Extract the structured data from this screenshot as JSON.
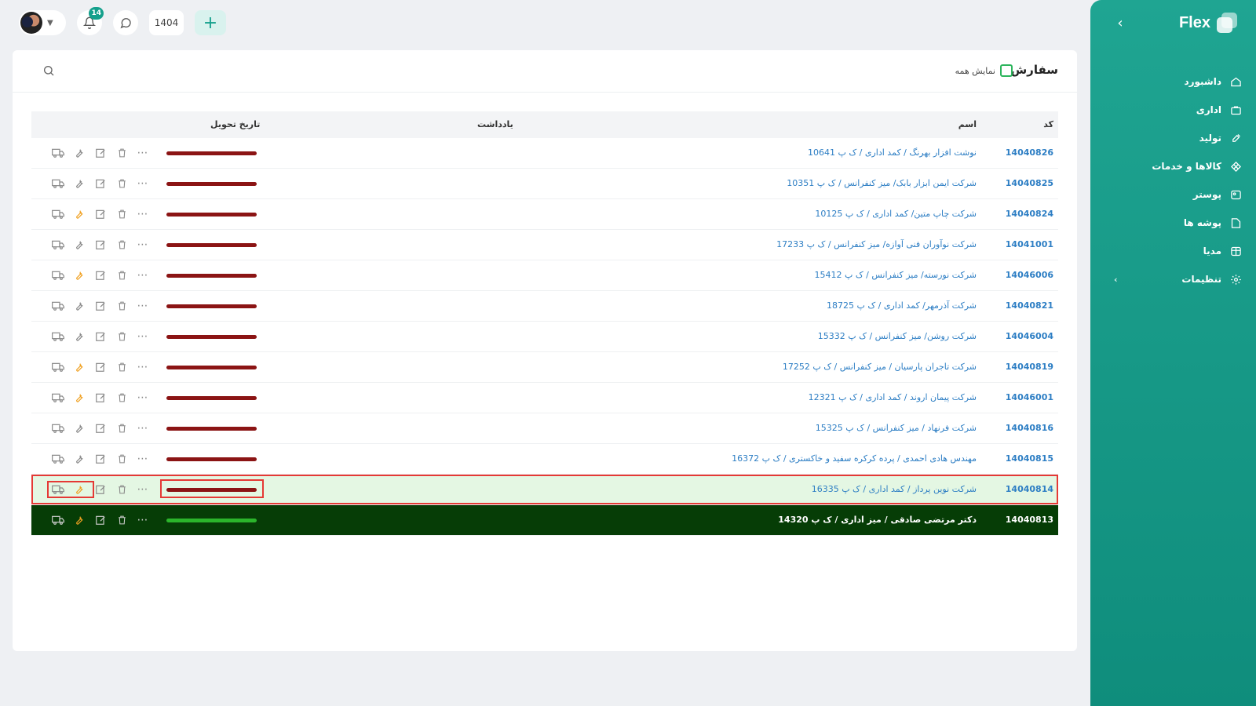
{
  "sidebar": {
    "brand": "Flex",
    "items": [
      {
        "label": "داشبورد",
        "icon": "home-icon"
      },
      {
        "label": "اداری",
        "icon": "briefcase-icon"
      },
      {
        "label": "تولید",
        "icon": "tools-icon"
      },
      {
        "label": "کالاها و خدمات",
        "icon": "diamond-icon"
      },
      {
        "label": "پوستر",
        "icon": "image-icon"
      },
      {
        "label": "پوشه ها",
        "icon": "folder-icon"
      },
      {
        "label": "مدیا",
        "icon": "media-icon"
      },
      {
        "label": "تنظیمات",
        "icon": "gear-icon"
      }
    ]
  },
  "topbar": {
    "notification_count": "14",
    "year": "1404"
  },
  "card": {
    "title": "سفارش",
    "show_all_label": "نمایش همه"
  },
  "table": {
    "headers": {
      "code": "کد",
      "name": "اسم",
      "note": "یادداشت",
      "delivery": "تاریخ تحویل"
    },
    "rows": [
      {
        "code": "14040826",
        "name": "نوشت افزار بهرنگ / کمد اداری / ک پ 10641",
        "wrench": "gray",
        "bar_color": "#8b1414"
      },
      {
        "code": "14040825",
        "name": "شرکت ایمن ابزار بابک/ میز کنفرانس / ک پ 10351",
        "wrench": "gray",
        "bar_color": "#8b1414"
      },
      {
        "code": "14040824",
        "name": "شرکت چاپ متین/ کمد اداری / ک پ 10125",
        "wrench": "orange",
        "bar_color": "#8b1414"
      },
      {
        "code": "14041001",
        "name": "شرکت نوآوران فنی آوازه/ میز کنفرانس / ک پ 17233",
        "wrench": "gray",
        "bar_color": "#8b1414"
      },
      {
        "code": "14046006",
        "name": "شرکت نورسته/ میز کنفرانس / ک پ 15412",
        "wrench": "orange",
        "bar_color": "#8b1414"
      },
      {
        "code": "14040821",
        "name": "شرکت آذرمهر/ کمد اداری / ک پ 18725",
        "wrench": "gray",
        "bar_color": "#8b1414"
      },
      {
        "code": "14046004",
        "name": "شرکت روشن/ میز کنفرانس / ک پ 15332",
        "wrench": "gray",
        "bar_color": "#8b1414"
      },
      {
        "code": "14040819",
        "name": "شرکت تاجران پارسیان / میز کنفرانس / ک پ 17252",
        "wrench": "orange",
        "bar_color": "#8b1414"
      },
      {
        "code": "14046001",
        "name": "شرکت پیمان اروند / کمد اداری / ک پ 12321",
        "wrench": "orange",
        "bar_color": "#8b1414"
      },
      {
        "code": "14040816",
        "name": "شرکت فرنهاد / میز کنفرانس / ک پ 15325",
        "wrench": "gray",
        "bar_color": "#8b1414"
      },
      {
        "code": "14040815",
        "name": "مهندس هادی احمدی / پرده کرکره سفید و خاکستری / ک پ 16372",
        "wrench": "gray",
        "bar_color": "#8b1414"
      },
      {
        "code": "14040814",
        "name": "شرکت نوین پرداز / کمد اداری / ک پ 16335",
        "wrench": "orange",
        "bar_color": "#8b1414",
        "style": "highlight"
      },
      {
        "code": "14040813",
        "name": "دکتر مرتضی صادقی / میز اداری / ک پ 14320",
        "wrench": "orange",
        "bar_color": "#2bb52b",
        "style": "dark"
      }
    ]
  },
  "colors": {
    "accent": "#14a08c",
    "link": "#2d7ec4",
    "overdue": "#8b1414",
    "done": "#2bb52b",
    "highlight_frame": "#e53935"
  }
}
